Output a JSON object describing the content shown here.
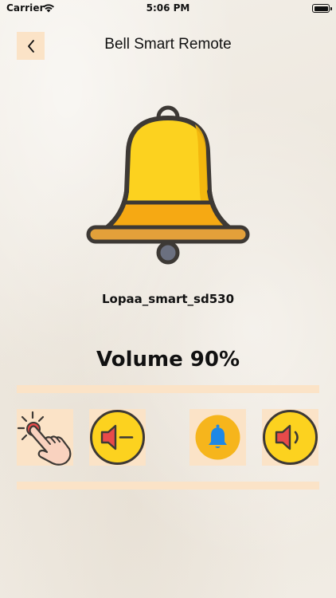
{
  "status_bar": {
    "carrier": "Carrier",
    "time": "5:06 PM",
    "icons": [
      "wifi-icon",
      "battery-icon"
    ]
  },
  "nav": {
    "title": "Bell Smart Remote",
    "back_icon": "chevron-left-icon"
  },
  "device": {
    "name": "Lopaa_smart_sd530",
    "image_icon": "bell-icon"
  },
  "volume": {
    "label": "Volume 90%",
    "level_percent": 90
  },
  "controls": [
    {
      "id": "ring",
      "icon": "tap-hand-icon"
    },
    {
      "id": "volume-down",
      "icon": "volume-down-icon"
    },
    {
      "id": "bell",
      "icon": "bell-icon"
    },
    {
      "id": "volume-up",
      "icon": "volume-up-icon"
    }
  ],
  "colors": {
    "accent_bg": "#fbe3c7",
    "bell_yellow": "#fcd21f",
    "bell_orange": "#f6a913",
    "outline": "#3d3935",
    "speaker_red": "#e84a4a",
    "bell_blue": "#1e88e5"
  }
}
